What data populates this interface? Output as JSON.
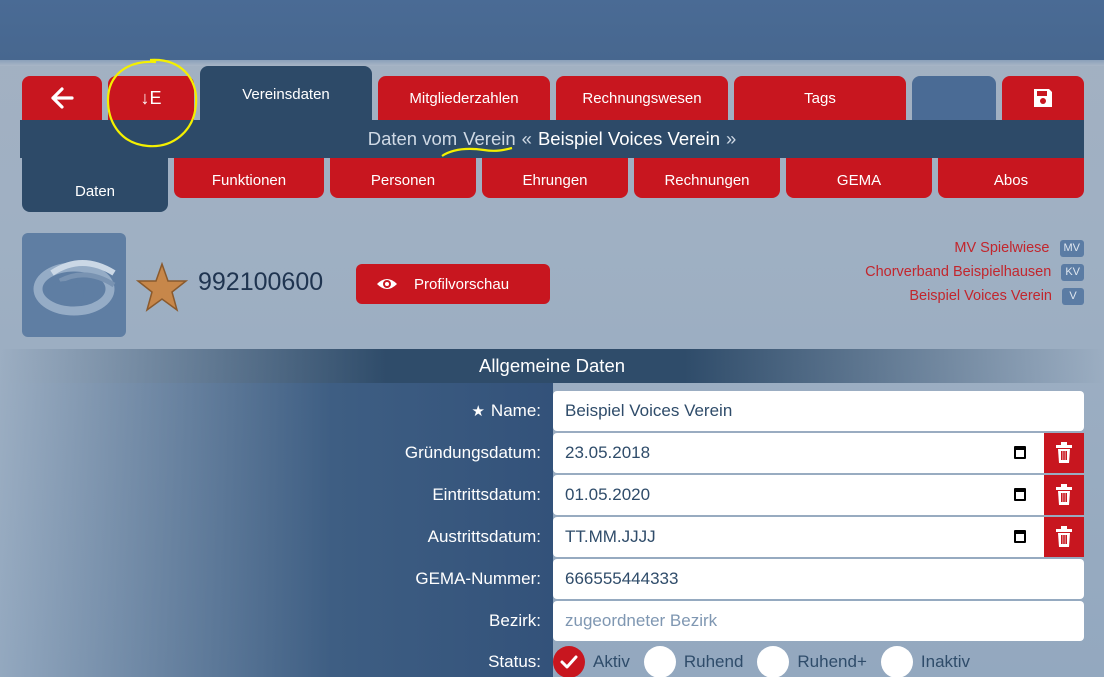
{
  "top_tabs": {
    "back_icon": "arrow-left-icon",
    "sort_label": "↓E",
    "vereinsdaten": "Vereinsdaten",
    "mitgliederzahlen": "Mitgliederzahlen",
    "rechnungswesen": "Rechnungswesen",
    "tags": "Tags",
    "save_icon": "floppy-disk-icon"
  },
  "infobar": {
    "prefix": "Daten vom",
    "word": "Verein",
    "open_quote": "«",
    "name": "Beispiel Voices Verein",
    "close_quote": "»"
  },
  "sub_tabs": [
    "Daten",
    "Funktionen",
    "Personen",
    "Ehrungen",
    "Rechnungen",
    "GEMA",
    "Abos"
  ],
  "profile": {
    "id": "992100600",
    "preview_label": "Profilvorschau",
    "star_icon": "star-icon",
    "eye_icon": "eye-icon"
  },
  "orgs": [
    {
      "name": "MV Spielwiese",
      "badge": "MV"
    },
    {
      "name": "Chorverband Beispielhausen",
      "badge": "KV"
    },
    {
      "name": "Beispiel Voices Verein",
      "badge": "V"
    }
  ],
  "section_title": "Allgemeine Daten",
  "form": {
    "name_label": "Name:",
    "name_value": "Beispiel Voices Verein",
    "gruendung_label": "Gründungsdatum:",
    "gruendung_value": "23.05.2018",
    "eintritt_label": "Eintrittsdatum:",
    "eintritt_value": "01.05.2020",
    "austritt_label": "Austrittsdatum:",
    "austritt_value": "TT.MM.JJJJ",
    "gema_label": "GEMA-Nummer:",
    "gema_value": "666555444333",
    "bezirk_label": "Bezirk:",
    "bezirk_placeholder": "zugeordneter Bezirk",
    "status_label": "Status:",
    "status_options": [
      "Aktiv",
      "Ruhend",
      "Ruhend+",
      "Inaktiv"
    ],
    "status_selected": "Aktiv"
  },
  "colors": {
    "accent_red": "#c8161f",
    "dark_blue": "#2d4a68",
    "annotation_yellow": "#f4f000"
  }
}
